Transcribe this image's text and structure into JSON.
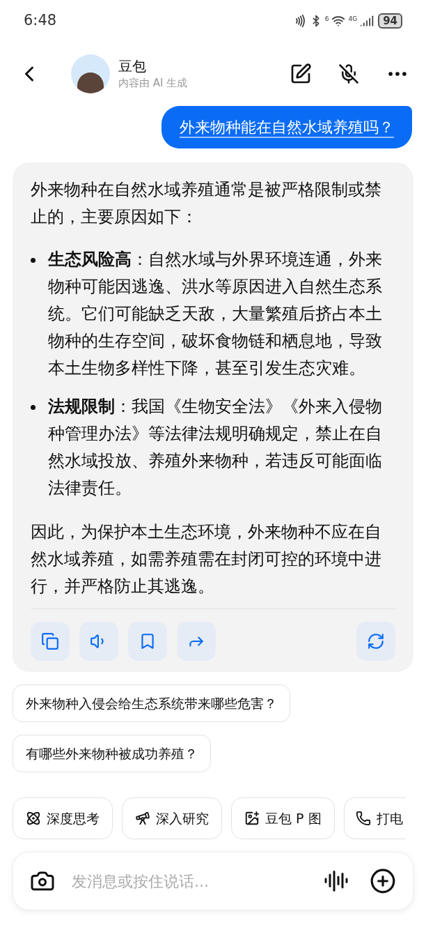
{
  "status_bar": {
    "time": "6:48",
    "wifi_badge": "6",
    "network": "4G",
    "battery": "94"
  },
  "header": {
    "name": "豆包",
    "subtitle": "内容由 AI 生成"
  },
  "user_message": "外来物种能在自然水域养殖吗？",
  "reply": {
    "intro": "外来物种在自然水域养殖通常是被严格限制或禁止的，主要原因如下：",
    "bullets": [
      "**生态风险高**：自然水域与外界环境连通，外来物种可能因逃逸、洪水等原因进入自然生态系统。它们可能缺乏天敌，大量繁殖后挤占本土物种的生存空间，破坏食物链和栖息地，导致本土生物多样性下降，甚至引发生态灾难。",
      "**法规限制**：我国《生物安全法》《外来入侵物种管理办法》等法律法规明确规定，禁止在自然水域投放、养殖外来物种，若违反可能面临法律责任。"
    ],
    "conclusion": "因此，为保护本土生态环境，外来物种不应在自然水域养殖，如需养殖需在封闭可控的环境中进行，并严格防止其逃逸。"
  },
  "suggestions": [
    "外来物种入侵会给生态系统带来哪些危害？",
    "有哪些外来物种被成功养殖？"
  ],
  "tools": [
    {
      "kind": "think",
      "label": "深度思考"
    },
    {
      "kind": "research",
      "label": "深入研究"
    },
    {
      "kind": "image",
      "label": "豆包 P 图"
    },
    {
      "kind": "call",
      "label": "打电"
    }
  ],
  "input": {
    "placeholder": "发消息或按住说话..."
  }
}
